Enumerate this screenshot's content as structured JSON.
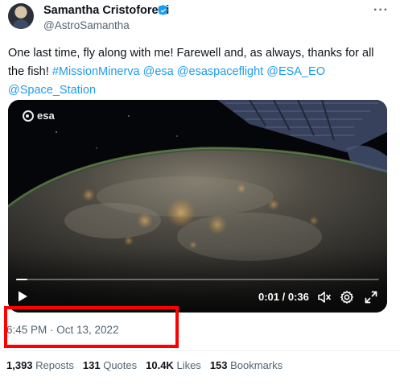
{
  "author": {
    "name": "Samantha Cristoforetti",
    "handle": "@AstroSamantha",
    "verified_icon": "verified-badge-icon",
    "verified_color": "#1d9bf0"
  },
  "more_icon": "more-options-icon",
  "tweet": {
    "text_plain_1": "One last time, fly along with me! Farewell and, as always, thanks for all the fish! ",
    "links": [
      "#MissionMinerva",
      "@esa",
      "@esaspaceflight",
      "@ESA_EO",
      "@Space_Station"
    ]
  },
  "video": {
    "watermark": "esa",
    "time": "0:01 / 0:36",
    "progress": 0.03,
    "controls": [
      "play-icon",
      "mute-icon",
      "settings-icon",
      "fullscreen-icon"
    ]
  },
  "timestamp": "6:45 PM · Oct 13, 2022",
  "highlight_color": "#ff0000",
  "stats": [
    {
      "num": "1,393",
      "label": "Reposts"
    },
    {
      "num": "131",
      "label": "Quotes"
    },
    {
      "num": "10.4K",
      "label": "Likes"
    },
    {
      "num": "153",
      "label": "Bookmarks"
    }
  ]
}
